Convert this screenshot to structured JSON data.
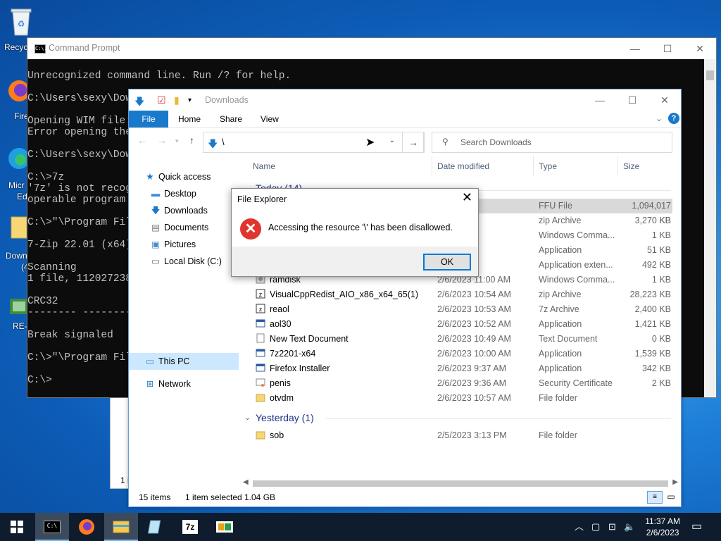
{
  "desktop": {
    "icons": [
      {
        "label": "Recyc",
        "icon": "recycle-bin-icon"
      },
      {
        "label": "Fire",
        "icon": "firefox-icon"
      },
      {
        "label": "Micr",
        "label2": "Ed",
        "icon": "edge-icon"
      },
      {
        "label": "Down",
        "label2": "(4",
        "icon": "folder-icon"
      },
      {
        "label": "RE-",
        "icon": "app-icon"
      }
    ],
    "bg_window_text": "1 i"
  },
  "cmd": {
    "title": "Command Prompt",
    "icon_text": "C:\\.",
    "lines": [
      "Unrecognized command line. Run /? for help.",
      "",
      "C:\\Users\\sexy\\Down",
      "",
      "Opening WIM file:",
      "Error opening the",
      "",
      "C:\\Users\\sexy\\Down",
      "",
      "C:\\>7z",
      "'7z' is not recogn",
      "operable program o",
      "",
      "C:\\>\"\\Program File",
      "",
      "7-Zip 22.01 (x64)",
      "",
      "Scanning",
      "1 file, 1120272384",
      "",
      "CRC32",
      "-------- ---------",
      "",
      "Break signaled",
      "",
      "C:\\>\"\\Program File",
      "",
      "C:\\>"
    ]
  },
  "explorer": {
    "title": "Downloads",
    "ribbon_tabs": [
      "File",
      "Home",
      "Share",
      "View"
    ],
    "address_path": "\\",
    "search_placeholder": "Search Downloads",
    "nav": {
      "quick_access": "Quick access",
      "desktop": "Desktop",
      "downloads": "Downloads",
      "documents": "Documents",
      "pictures": "Pictures",
      "local_disk": "Local Disk (C:)",
      "this_pc": "This PC",
      "network": "Network"
    },
    "columns": {
      "name": "Name",
      "date": "Date modified",
      "type": "Type",
      "size": "Size"
    },
    "group_today": "Today (14)",
    "group_yesterday": "Yesterday (1)",
    "rows_partial": [
      {
        "date": ":36 AM",
        "type": "FFU File",
        "size": "1,094,017 KB"
      },
      {
        "date": ":34 AM",
        "type": "zip Archive",
        "size": "3,270 KB"
      },
      {
        "date": ":32 AM",
        "type": "Windows Comma...",
        "size": "1 KB"
      },
      {
        "date": ":32 AM",
        "type": "Application",
        "size": "51 KB"
      },
      {
        "date": ":31 AM",
        "type": "Application exten...",
        "size": "492 KB"
      }
    ],
    "rows": [
      {
        "name": "ramdisk",
        "date": "2/6/2023 11:00 AM",
        "type": "Windows Comma...",
        "size": "1 KB"
      },
      {
        "name": "VisualCppRedist_AIO_x86_x64_65(1)",
        "date": "2/6/2023 10:54 AM",
        "type": "zip Archive",
        "size": "28,223 KB"
      },
      {
        "name": "reaol",
        "date": "2/6/2023 10:53 AM",
        "type": "7z Archive",
        "size": "2,400 KB"
      },
      {
        "name": "aol30",
        "date": "2/6/2023 10:52 AM",
        "type": "Application",
        "size": "1,421 KB"
      },
      {
        "name": "New Text Document",
        "date": "2/6/2023 10:49 AM",
        "type": "Text Document",
        "size": "0 KB"
      },
      {
        "name": "7z2201-x64",
        "date": "2/6/2023 10:00 AM",
        "type": "Application",
        "size": "1,539 KB"
      },
      {
        "name": "Firefox Installer",
        "date": "2/6/2023 9:37 AM",
        "type": "Application",
        "size": "342 KB"
      },
      {
        "name": "penis",
        "date": "2/6/2023 9:36 AM",
        "type": "Security Certificate",
        "size": "2 KB"
      },
      {
        "name": "otvdm",
        "date": "2/6/2023 10:57 AM",
        "type": "File folder",
        "size": ""
      }
    ],
    "rows_yesterday": [
      {
        "name": "sob",
        "date": "2/5/2023 3:13 PM",
        "type": "File folder",
        "size": ""
      }
    ],
    "status": {
      "items": "15 items",
      "selected": "1 item selected",
      "size": "1.04 GB"
    }
  },
  "dialog": {
    "title": "File Explorer",
    "message": "Accessing the resource '\\' has been disallowed.",
    "ok_label": "OK",
    "icon": "error-icon"
  },
  "taskbar": {
    "time": "11:37 AM",
    "date": "2/6/2023",
    "apps": [
      "cmd-icon",
      "firefox-icon",
      "file-explorer-icon",
      "notepad-icon",
      "7zip-icon",
      "app-icon"
    ],
    "zip_label": "7z"
  },
  "colors": {
    "accent": "#1979ca",
    "selection": "#cce8ff",
    "taskbar": "#0f1c2e",
    "error": "#e0342f"
  }
}
